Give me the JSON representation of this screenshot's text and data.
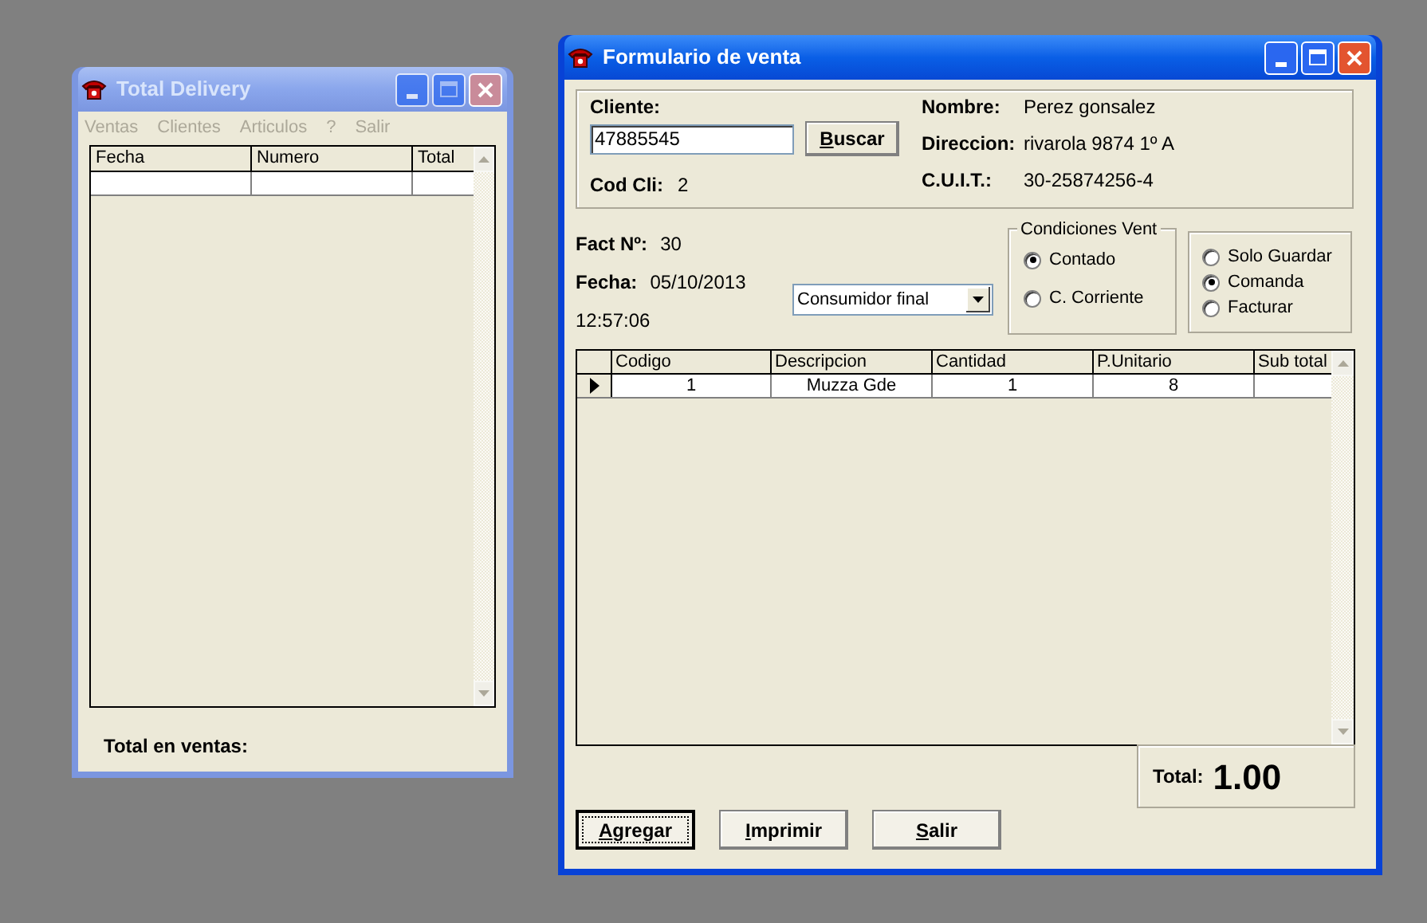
{
  "delivery_window": {
    "title": "Total Delivery",
    "active": false,
    "menu": [
      {
        "label": "Ventas",
        "disabled": true
      },
      {
        "label": "Clientes",
        "disabled": true
      },
      {
        "label": "Articulos",
        "disabled": true
      },
      {
        "label": "?",
        "disabled": true
      },
      {
        "label": "Salir",
        "disabled": true
      }
    ],
    "table": {
      "columns": [
        "Fecha",
        "Numero",
        "Total"
      ]
    },
    "total_label": "Total en ventas:"
  },
  "sale_window": {
    "title": "Formulario de venta",
    "active": true,
    "client": {
      "label": "Cliente:",
      "value": "47885545",
      "search_button": {
        "label": "Buscar",
        "mnemonic": true
      },
      "code_label": "Cod Cli:",
      "code": "2",
      "fields": [
        {
          "label": "Nombre:",
          "value": "Perez gonsalez"
        },
        {
          "label": "Direccion:",
          "value": "rivarola 9874 1º A"
        },
        {
          "label": "C.U.I.T.:",
          "value": "30-25874256-4"
        }
      ]
    },
    "invoice": {
      "number_label": "Fact Nº:",
      "number": "30",
      "date_label": "Fecha:",
      "date": "05/10/2013",
      "time": "12:57:06"
    },
    "customer_type": "Consumidor final",
    "conditions": {
      "title": "Condiciones Vent",
      "options": [
        {
          "label": "Contado",
          "selected": true
        },
        {
          "label": "C. Corriente",
          "selected": false
        }
      ]
    },
    "action": {
      "options": [
        {
          "label": "Solo Guardar",
          "selected": false
        },
        {
          "label": "Comanda",
          "selected": true
        },
        {
          "label": "Facturar",
          "selected": false
        }
      ]
    },
    "table": {
      "columns": [
        "Codigo",
        "Descripcion",
        "Cantidad",
        "P.Unitario",
        "Sub total"
      ],
      "rows": [
        {
          "current": true,
          "cells": [
            "1",
            "Muzza Gde",
            "1",
            "8"
          ]
        }
      ]
    },
    "total": {
      "label": "Total:",
      "value": "1.00"
    },
    "buttons": [
      {
        "label": "Agregar",
        "mnemonic": true,
        "focused": true
      },
      {
        "label": "Imprimir",
        "mnemonic": true,
        "focused": false
      },
      {
        "label": "Salir",
        "mnemonic": true,
        "focused": false
      }
    ]
  }
}
